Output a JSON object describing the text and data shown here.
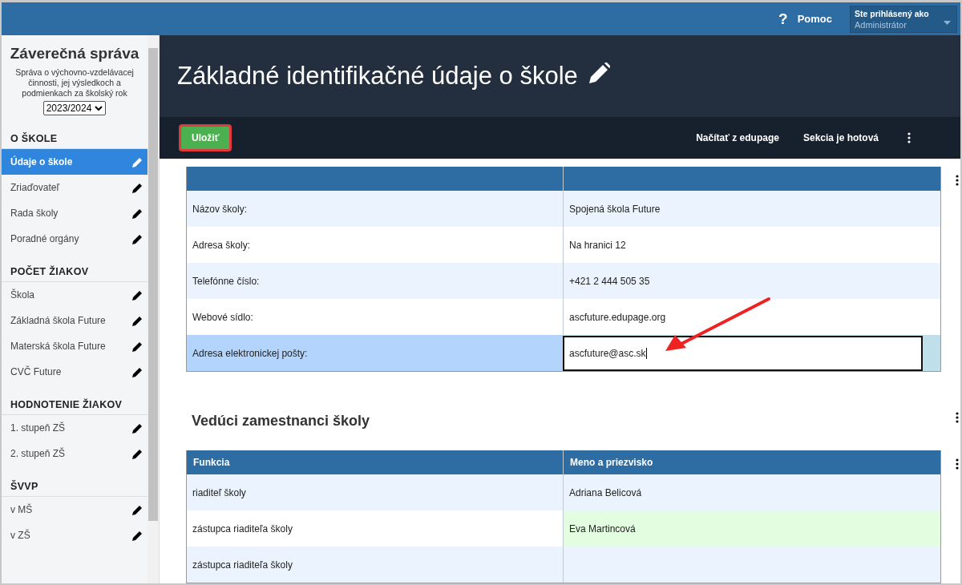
{
  "top_bar": {
    "help": {
      "icon": "?",
      "label": "Pomoc"
    },
    "user": {
      "caption": "Ste prihlásený ako",
      "role": "Administrátor"
    }
  },
  "sidebar": {
    "title": "Záverečná správa",
    "subtitle": "Správa o výchovno-vzdelávacej činnosti, jej výsledkoch a podmienkach za školský rok",
    "year": "2023/2024",
    "sections": [
      {
        "heading": "O ŠKOLE",
        "items": [
          {
            "label": "Údaje o škole",
            "selected": true
          },
          {
            "label": "Zriaďovateľ",
            "selected": false
          },
          {
            "label": "Rada školy",
            "selected": false
          },
          {
            "label": "Poradné orgány",
            "selected": false
          }
        ]
      },
      {
        "heading": "POČET ŽIAKOV",
        "items": [
          {
            "label": "Škola",
            "selected": false
          },
          {
            "label": "Základná škola Future",
            "selected": false
          },
          {
            "label": "Materská škola Future",
            "selected": false
          },
          {
            "label": "CVČ Future",
            "selected": false
          }
        ]
      },
      {
        "heading": "HODNOTENIE ŽIAKOV",
        "items": [
          {
            "label": "1. stupeň ZŠ",
            "selected": false
          },
          {
            "label": "2. stupeň ZŠ",
            "selected": false
          }
        ]
      },
      {
        "heading": "ŠVVP",
        "items": [
          {
            "label": "v MŠ",
            "selected": false
          },
          {
            "label": "v ZŠ",
            "selected": false
          }
        ]
      }
    ]
  },
  "page": {
    "title": "Základné identifikačné údaje o škole"
  },
  "toolbar": {
    "save": "Uložiť",
    "actions": [
      "Načítať z edupage",
      "Sekcia je hotová"
    ]
  },
  "info_table": {
    "rows": [
      {
        "label": "Názov školy:",
        "value": "Spojená škola Future",
        "selected": false
      },
      {
        "label": "Adresa školy:",
        "value": "Na hranici 12",
        "selected": false
      },
      {
        "label": "Telefónne číslo:",
        "value": "+421 2 444 505 35",
        "selected": false
      },
      {
        "label": "Webové sídlo:",
        "value": "ascfuture.edupage.org",
        "selected": false
      },
      {
        "label": "Adresa elektronickej pošty:",
        "value": "ascfuture@asc.sk",
        "selected": true
      }
    ]
  },
  "staff": {
    "heading": "Vedúci zamestnanci školy",
    "columns": [
      "Funkcia",
      "Meno a priezvisko"
    ],
    "rows": [
      {
        "function": "riaditeľ školy",
        "name": "Adriana Belicová",
        "highlighted": false
      },
      {
        "function": "zástupca riaditeľa školy",
        "name": "Eva Martincová",
        "highlighted": true
      },
      {
        "function": "zástupca riaditeľa školy",
        "highlighted": false
      }
    ]
  }
}
